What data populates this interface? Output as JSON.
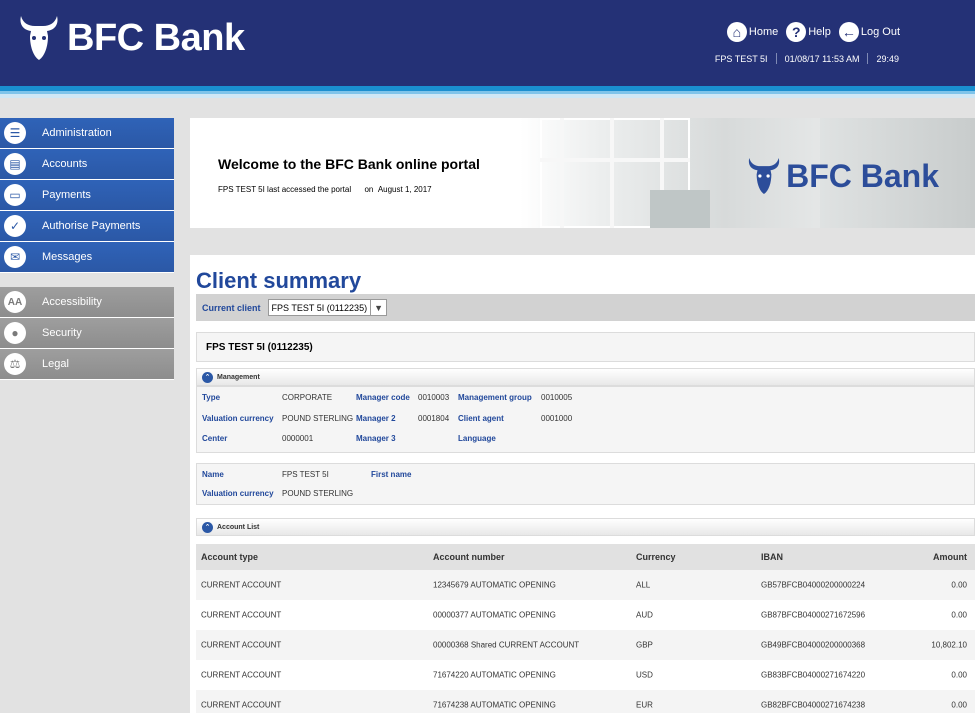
{
  "brand": {
    "name": "BFC Bank"
  },
  "top_nav": {
    "home": "Home",
    "help": "Help",
    "logout": "Log Out"
  },
  "status": {
    "user": "FPS TEST 5I",
    "datetime": "01/08/17 11:53 AM",
    "timer": "29:49"
  },
  "sidebar": {
    "primary": [
      {
        "label": "Administration",
        "icon": "list-icon"
      },
      {
        "label": "Accounts",
        "icon": "document-icon"
      },
      {
        "label": "Payments",
        "icon": "payments-icon"
      },
      {
        "label": "Authorise Payments",
        "icon": "thumbs-up-icon"
      },
      {
        "label": "Messages",
        "icon": "envelope-icon"
      }
    ],
    "secondary": [
      {
        "label": "Accessibility",
        "icon": "text-size-icon"
      },
      {
        "label": "Security",
        "icon": "lock-icon"
      },
      {
        "label": "Legal",
        "icon": "gavel-icon"
      }
    ]
  },
  "banner": {
    "title": "Welcome to the BFC Bank online portal",
    "sub_prefix": "FPS TEST 5I last accessed the portal",
    "sub_on": "on",
    "sub_date": "August 1, 2017"
  },
  "summary": {
    "title": "Client summary",
    "current_client_label": "Current client",
    "current_client_value": "FPS TEST 5I (0112235)",
    "client_header": "FPS TEST 5I (0112235)"
  },
  "management": {
    "section_title": "Management",
    "type_label": "Type",
    "type_value": "CORPORATE",
    "manager_code_label": "Manager code",
    "manager_code_value": "0010003",
    "management_group_label": "Management group",
    "management_group_value": "0010005",
    "valuation_currency_label": "Valuation currency",
    "valuation_currency_value": "POUND STERLING",
    "manager2_label": "Manager 2",
    "manager2_value": "0001804",
    "client_agent_label": "Client agent",
    "client_agent_value": "0001000",
    "center_label": "Center",
    "center_value": "0000001",
    "manager3_label": "Manager 3",
    "language_label": "Language"
  },
  "client_info": {
    "name_label": "Name",
    "name_value": "FPS TEST 5I",
    "first_name_label": "First name",
    "valuation_currency_label": "Valuation currency",
    "valuation_currency_value": "POUND STERLING"
  },
  "account_list": {
    "section_title": "Account List",
    "columns": [
      "Account type",
      "Account number",
      "Currency",
      "IBAN",
      "Amount"
    ],
    "rows": [
      [
        "CURRENT ACCOUNT",
        "12345679 AUTOMATIC OPENING",
        "ALL",
        "GB57BFCB04000200000224",
        "0.00"
      ],
      [
        "CURRENT ACCOUNT",
        "00000377 AUTOMATIC OPENING",
        "AUD",
        "GB87BFCB04000271672596",
        "0.00"
      ],
      [
        "CURRENT ACCOUNT",
        "00000368 Shared CURRENT ACCOUNT",
        "GBP",
        "GB49BFCB04000200000368",
        "10,802.10"
      ],
      [
        "CURRENT ACCOUNT",
        "71674220 AUTOMATIC OPENING",
        "USD",
        "GB83BFCB04000271674220",
        "0.00"
      ],
      [
        "CURRENT ACCOUNT",
        "71674238 AUTOMATIC OPENING",
        "EUR",
        "GB82BFCB04000271674238",
        "0.00"
      ]
    ]
  },
  "colors": {
    "header_bg": "#243176",
    "nav_blue": "#2b58a6",
    "nav_grey": "#8d8d8d",
    "title_blue": "#21489b"
  }
}
